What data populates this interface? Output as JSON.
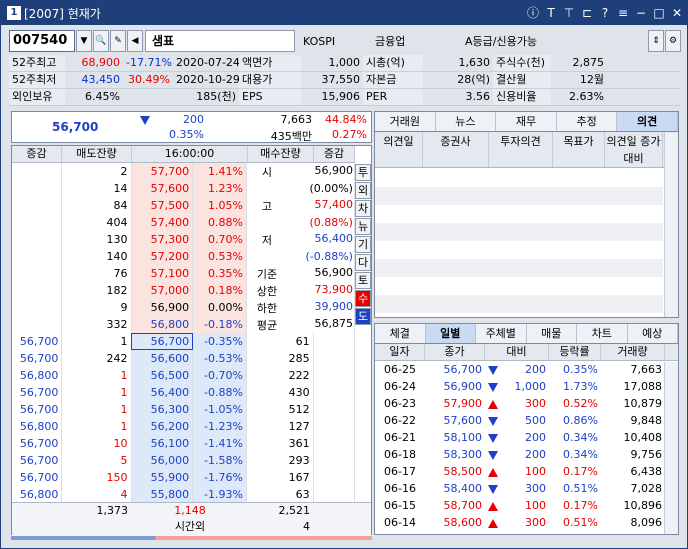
{
  "window": {
    "title": "[2007] 현재가"
  },
  "toolbar": {
    "code": "007540",
    "name": "샘표",
    "market": "KOSPI",
    "sector": "금융업",
    "grade": "A등급/신용가능"
  },
  "info": [
    [
      "52주최고",
      "68,900",
      "-17.71%",
      "2020-07-24",
      "액면가",
      "1,000",
      "시총(억)",
      "1,630",
      "주식수(천)",
      "2,875"
    ],
    [
      "52주최저",
      "43,450",
      "30.49%",
      "2020-10-29",
      "대용가",
      "37,550",
      "자본금",
      "28(억)",
      "결산월",
      "12월"
    ],
    [
      "외인보유",
      "6.45%",
      "",
      "185(천)",
      "EPS",
      "15,906",
      "PER",
      "3.56",
      "신용비율",
      "2.63%"
    ]
  ],
  "summary": {
    "price": "56,700",
    "change": "200",
    "rate": "0.35%",
    "volume": "7,663",
    "vol_rate": "44.84%",
    "amount": "435백만",
    "amt_rate": "0.27%"
  },
  "orderbook": {
    "headers": [
      "증감",
      "매도잔량",
      "16:00:00",
      "매수잔량",
      "증감"
    ],
    "asks": [
      [
        "2",
        "57,700",
        "1.41%"
      ],
      [
        "14",
        "57,600",
        "1.23%"
      ],
      [
        "84",
        "57,500",
        "1.05%"
      ],
      [
        "404",
        "57,400",
        "0.88%"
      ],
      [
        "130",
        "57,300",
        "0.70%"
      ],
      [
        "140",
        "57,200",
        "0.53%"
      ],
      [
        "76",
        "57,100",
        "0.35%"
      ],
      [
        "182",
        "57,000",
        "0.18%"
      ],
      [
        "9",
        "56,900",
        "0.00%"
      ],
      [
        "332",
        "56,800",
        "-0.18%"
      ]
    ],
    "bids": [
      [
        "56,700",
        "-0.35%",
        "61"
      ],
      [
        "56,600",
        "-0.53%",
        "285"
      ],
      [
        "56,500",
        "-0.70%",
        "222"
      ],
      [
        "56,400",
        "-0.88%",
        "430"
      ],
      [
        "56,300",
        "-1.05%",
        "512"
      ],
      [
        "56,200",
        "-1.23%",
        "127"
      ],
      [
        "56,100",
        "-1.41%",
        "361"
      ],
      [
        "56,000",
        "-1.58%",
        "293"
      ],
      [
        "55,900",
        "-1.76%",
        "167"
      ],
      [
        "55,800",
        "-1.93%",
        "63"
      ]
    ],
    "ticks": [
      [
        "56,700",
        "1"
      ],
      [
        "56,700",
        "242"
      ],
      [
        "56,800",
        "1"
      ],
      [
        "56,700",
        "1"
      ],
      [
        "56,700",
        "1"
      ],
      [
        "56,800",
        "1"
      ],
      [
        "56,700",
        "10"
      ],
      [
        "56,700",
        "5"
      ],
      [
        "56,700",
        "150"
      ],
      [
        "56,800",
        "4"
      ]
    ],
    "side": [
      [
        "시",
        "56,900"
      ],
      [
        "",
        "(0.00%)"
      ],
      [
        "고",
        "57,400"
      ],
      [
        "",
        "(0.88%)"
      ],
      [
        "저",
        "56,400"
      ],
      [
        "",
        "(-0.88%)"
      ],
      [
        "기준",
        "56,900"
      ],
      [
        "상한",
        "73,900"
      ],
      [
        "하한",
        "39,900"
      ],
      [
        "평균",
        "56,875"
      ]
    ],
    "sell_total": "1,373",
    "buy_total": "2,521",
    "diff": "1,148",
    "after_label": "시간외",
    "after_val": "4"
  },
  "vtabs": [
    "투",
    "외",
    "차",
    "뉴",
    "기",
    "다",
    "토",
    "수",
    "도"
  ],
  "right_tabs": [
    "거래원",
    "뉴스",
    "재무",
    "추정",
    "의견"
  ],
  "opinion_headers": [
    "의견일",
    "증권사",
    "투자의견",
    "목표가",
    "의견일 증가대비"
  ],
  "daily_tabs": [
    "체결",
    "일별",
    "주체별",
    "매물",
    "차트",
    "예상"
  ],
  "daily_headers": [
    "일자",
    "종가",
    "대비",
    "등락률",
    "거래량"
  ],
  "daily": [
    [
      "06-25",
      "56,700",
      "dn",
      "200",
      "0.35%",
      "7,663"
    ],
    [
      "06-24",
      "56,900",
      "dn",
      "1,000",
      "1.73%",
      "17,088"
    ],
    [
      "06-23",
      "57,900",
      "up",
      "300",
      "0.52%",
      "10,879"
    ],
    [
      "06-22",
      "57,600",
      "dn",
      "500",
      "0.86%",
      "9,848"
    ],
    [
      "06-21",
      "58,100",
      "dn",
      "200",
      "0.34%",
      "10,408"
    ],
    [
      "06-18",
      "58,300",
      "dn",
      "200",
      "0.34%",
      "9,756"
    ],
    [
      "06-17",
      "58,500",
      "up",
      "100",
      "0.17%",
      "6,438"
    ],
    [
      "06-16",
      "58,400",
      "dn",
      "300",
      "0.51%",
      "7,028"
    ],
    [
      "06-15",
      "58,700",
      "up",
      "100",
      "0.17%",
      "10,896"
    ],
    [
      "06-14",
      "58,600",
      "up",
      "300",
      "0.51%",
      "8,096"
    ]
  ]
}
